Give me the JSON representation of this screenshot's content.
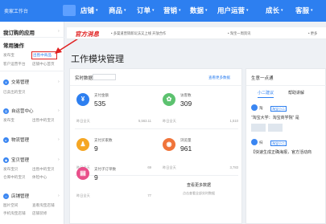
{
  "header": {
    "brand": "卖家工作台",
    "nav": [
      "店铺",
      "商品",
      "订单",
      "营销",
      "数据",
      "用户运营",
      "成长",
      "客服"
    ]
  },
  "sidebar": {
    "my_apps": "我订购的应用",
    "common_ops": "常用操作",
    "common_links": [
      {
        "label": "发布宝",
        "x": 4,
        "y": 43
      },
      {
        "label": "出售中商品",
        "x": 40,
        "y": 43
      },
      {
        "label": "客户运营平台",
        "x": 4,
        "y": 54
      },
      {
        "label": "店铺中心首页",
        "x": 40,
        "y": 54
      }
    ],
    "sections": [
      {
        "label": "交易管理",
        "links": [
          "已卖出的宝贝",
          "",
          ""
        ]
      },
      {
        "label": "自运营中心",
        "links": [
          "发布宝",
          "出售中的宝贝",
          ""
        ]
      },
      {
        "label": "物流管理",
        "links": []
      },
      {
        "label": "宝贝管理",
        "links": [
          "发布宝贝",
          "出售中的宝贝",
          "仓库中的宝贝",
          "体检中心"
        ]
      },
      {
        "label": "店铺管理",
        "links": [
          "图片空间",
          "查看淘宝店铺",
          "手机淘宝店铺",
          "店铺装修"
        ]
      }
    ]
  },
  "tip": {
    "label": "官方消息",
    "text1": "• 多渠道营销新玩法又上线 开放合作",
    "text2": "• 淘宝一周资讯",
    "text3": "• 更多"
  },
  "page_title": "工作模块管理",
  "main_card": {
    "header": "实时数据",
    "select": "",
    "link": "查看更多数据",
    "metrics": [
      {
        "label": "支付金额",
        "value": "535",
        "foot_left": "昨日全天",
        "foot_right": "5,563.11",
        "icon": "¥",
        "color": "#2d7ff0"
      },
      {
        "label": "访客数",
        "value": "309",
        "foot_left": "昨日全天",
        "foot_right": "1,510",
        "icon": "✿",
        "color": "#5cc26f"
      },
      {
        "label": "支付买家数",
        "value": "9",
        "foot_left": "昨日全天",
        "foot_right": "69",
        "icon": "♟",
        "color": "#f5a623"
      },
      {
        "label": "浏览量",
        "value": "961",
        "foot_left": "昨日全天",
        "foot_right": "3,783",
        "icon": "◉",
        "color": "#f0743a"
      },
      {
        "label": "支付子订单数",
        "value": "9",
        "foot_left": "昨日全天",
        "foot_right": "77",
        "icon": "▤",
        "color": "#e94f8a"
      }
    ],
    "more_title": "查看更多数据",
    "more_sub": "点击查看全部实时数据"
  },
  "right_card": {
    "header": "生意一点通",
    "tabs": [
      "小二建议",
      "帮助讲解"
    ],
    "items": [
      {
        "name": "淘",
        "badge": "淘宝小二",
        "text": "“淘宝大学：淘宝商学院” 是"
      },
      {
        "name": "扫",
        "badge": "淘宝小二",
        "text": "【快速生成正确海报，官方活动商"
      }
    ]
  }
}
